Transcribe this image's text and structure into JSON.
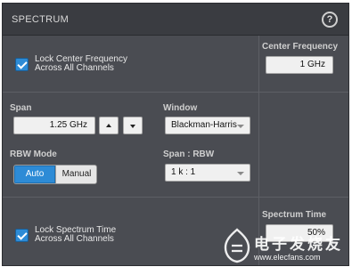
{
  "panel": {
    "title": "SPECTRUM",
    "help_icon": "?"
  },
  "lock_center": {
    "checked": true,
    "line1": "Lock Center Frequency",
    "line2": "Across All Channels"
  },
  "center_frequency": {
    "label": "Center Frequency",
    "value": "1 GHz"
  },
  "span": {
    "label": "Span",
    "value": "1.25 GHz"
  },
  "window": {
    "label": "Window",
    "value": "Blackman-Harris"
  },
  "rbw_mode": {
    "label": "RBW Mode",
    "options": [
      "Auto",
      "Manual"
    ],
    "selected": "Auto"
  },
  "span_rbw": {
    "label": "Span : RBW",
    "value": "1 k : 1"
  },
  "lock_spectrum_time": {
    "checked": true,
    "line1": "Lock Spectrum Time",
    "line2": "Across All Channels"
  },
  "spectrum_time": {
    "label": "Spectrum Time",
    "value": "50%"
  },
  "watermark": {
    "cn": "电子发烧友",
    "url": "www.elecfans.com"
  },
  "colors": {
    "accent": "#2d8bd6",
    "panel": "#4a4c52",
    "titlebar": "#3a3c41"
  }
}
